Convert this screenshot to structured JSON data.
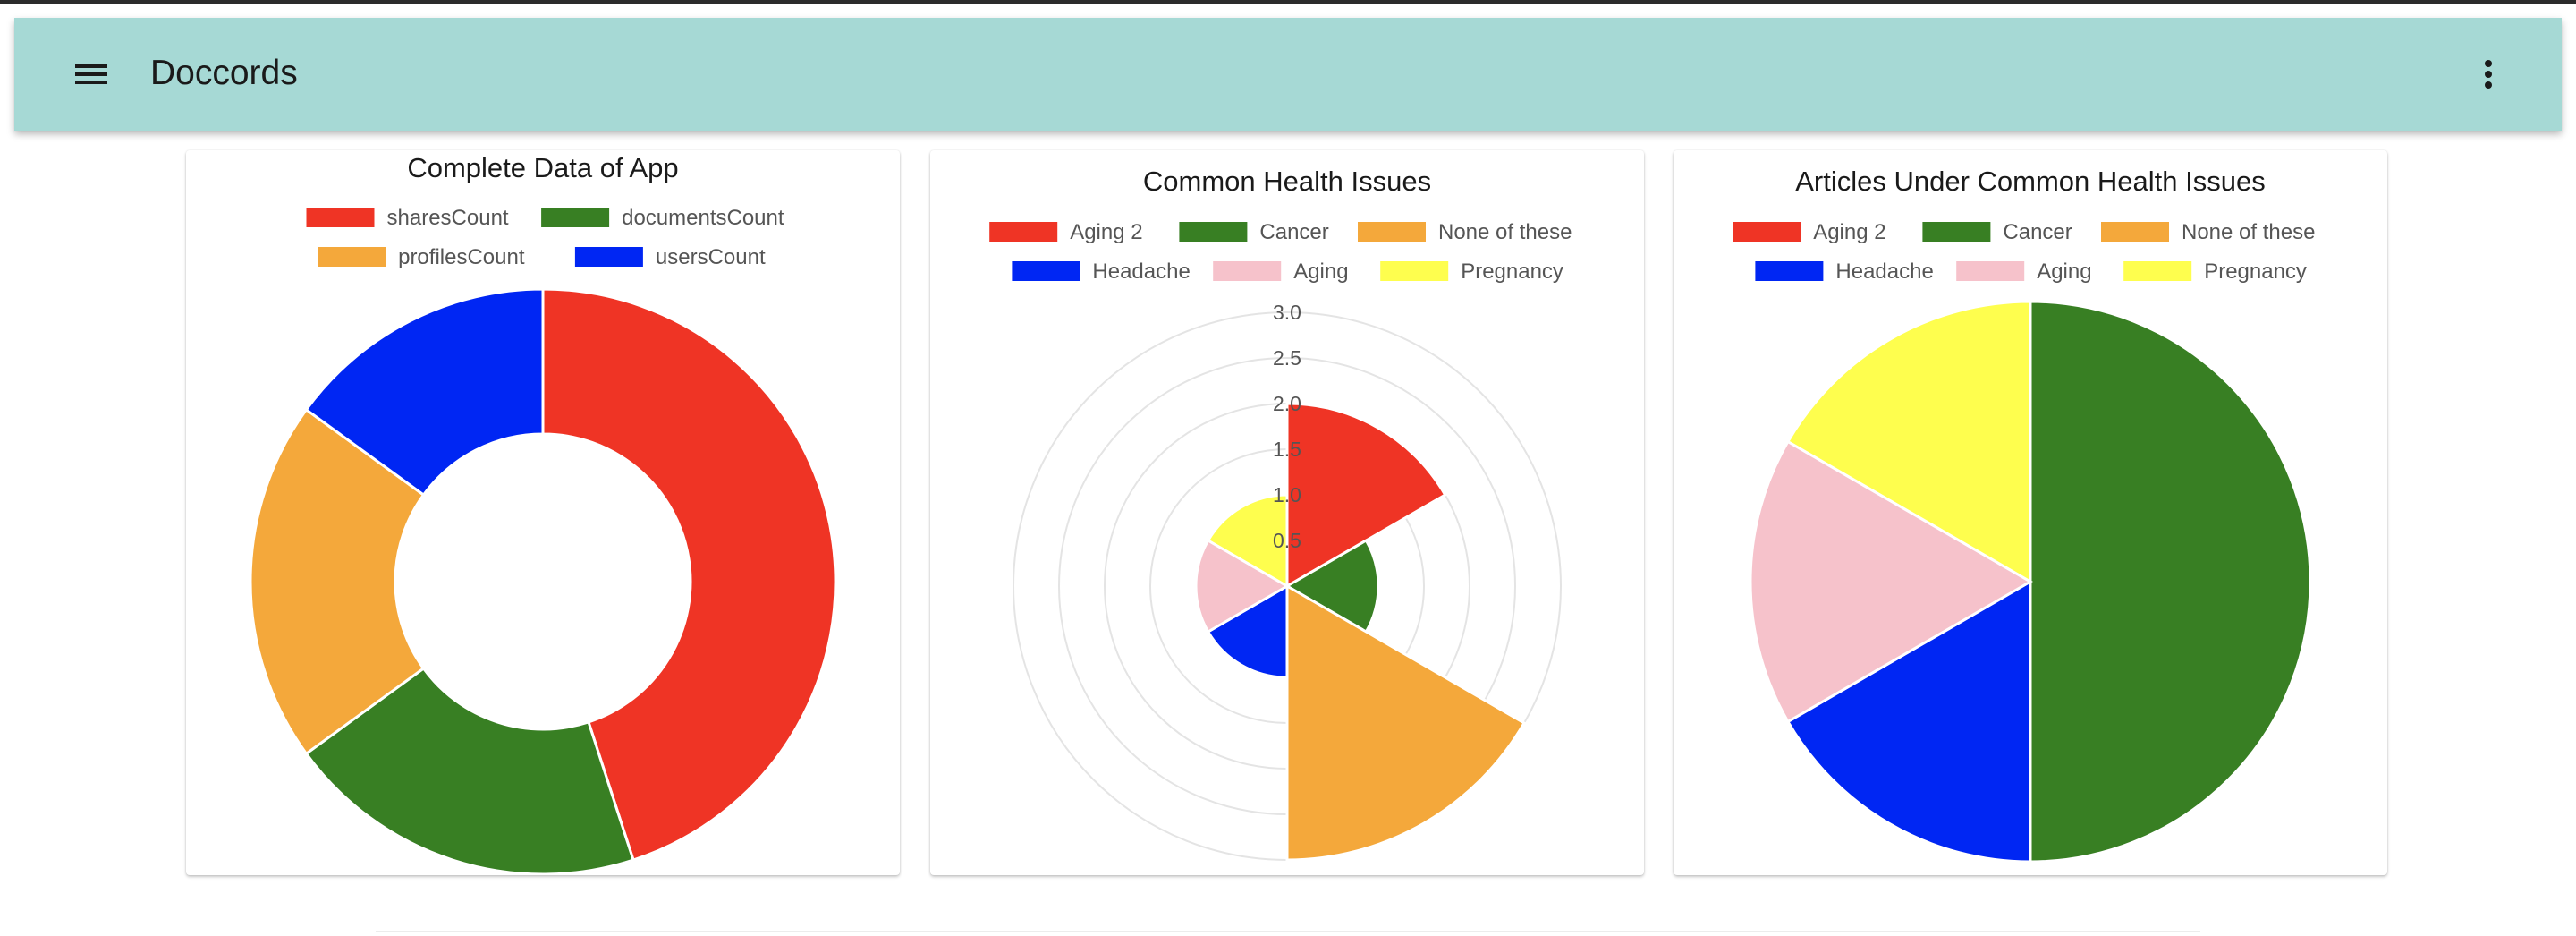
{
  "app": {
    "title": "Doccords",
    "menu_icon": "menu-icon",
    "more_icon": "more-vert-icon"
  },
  "chart_data": [
    {
      "type": "doughnut",
      "title": "Complete Data of App",
      "legend_position": "top",
      "categories": [
        "sharesCount",
        "documentsCount",
        "profilesCount",
        "usersCount"
      ],
      "values": [
        9,
        4,
        4,
        3
      ],
      "colors": [
        "#ef3425",
        "#387f23",
        "#f4a83b",
        "#0026f3"
      ]
    },
    {
      "type": "polarArea",
      "title": "Common Health Issues",
      "legend_position": "top",
      "categories": [
        "Aging 2",
        "Cancer",
        "None of these",
        "Headache",
        "Aging",
        "Pregnancy"
      ],
      "values": [
        2,
        1,
        3,
        1,
        1,
        1
      ],
      "colors": [
        "#ef3425",
        "#387f23",
        "#f4a83b",
        "#0026f3",
        "#f6c2cb",
        "#fefe4e"
      ],
      "r_axis": {
        "min": 0,
        "max": 3,
        "step": 0.5,
        "ticks": [
          "0.5",
          "1.0",
          "1.5",
          "2.0",
          "2.5",
          "3.0"
        ]
      },
      "grid": true
    },
    {
      "type": "pie",
      "title": "Articles Under Common Health Issues",
      "legend_position": "top",
      "categories": [
        "Aging 2",
        "Cancer",
        "None of these",
        "Headache",
        "Aging",
        "Pregnancy"
      ],
      "values": [
        0,
        3,
        0,
        1,
        1,
        1
      ],
      "colors": [
        "#ef3425",
        "#387f23",
        "#f4a83b",
        "#0026f3",
        "#f6c2cb",
        "#fefe4e"
      ]
    }
  ]
}
